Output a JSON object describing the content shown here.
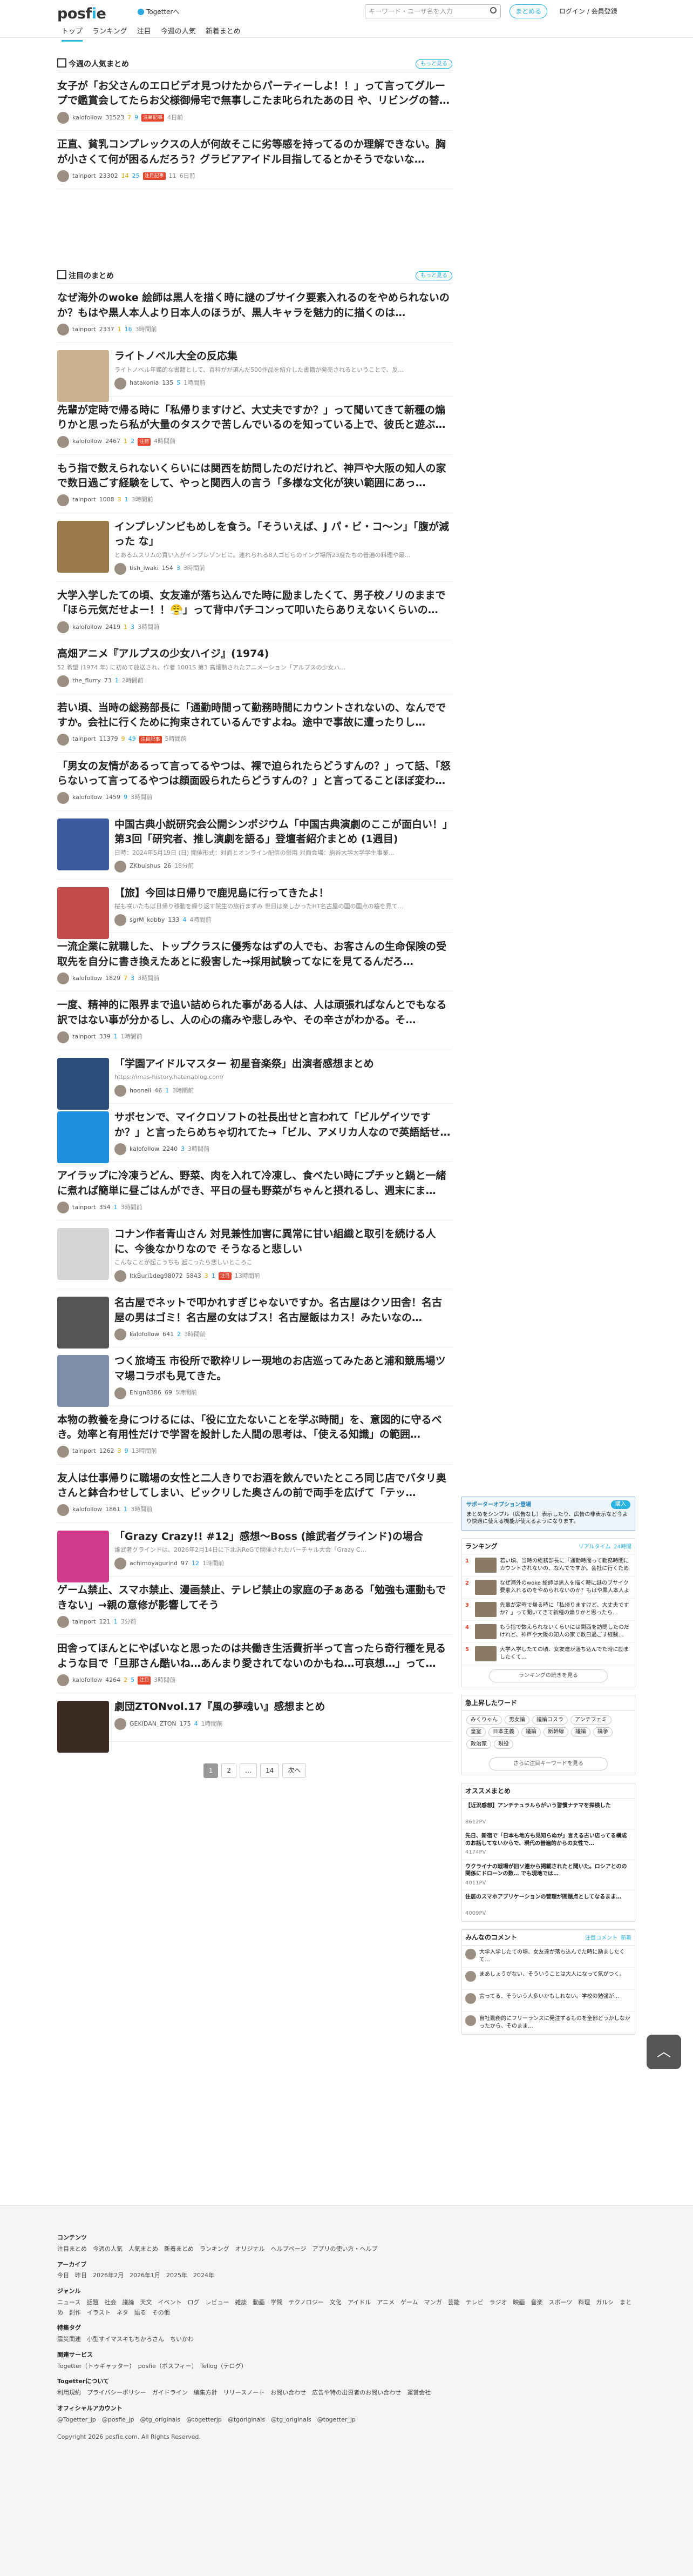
{
  "header": {
    "logo": "posfie",
    "togetter": "Togetterへ",
    "nav": [
      "トップ",
      "ランキング",
      "注目",
      "今週の人気",
      "新着まとめ"
    ],
    "search_placeholder": "キーワード・ユーザ名を入力",
    "create": "まとめる",
    "login": "ログイン / 会員登録"
  },
  "weekly": {
    "title": "今週の人気まとめ",
    "more": "もっと見る",
    "items": [
      {
        "title": "女子が「お父さんのエロビデオ見つけたからパーティーしよ！！」って言ってグループで鑑賞会してたらお父様御帰宅で無事しこたま叱られたあの日 や、リビングの替…",
        "user": "kalofollow",
        "views": "31523",
        "a": "7",
        "b": "9",
        "hot": "注目記事",
        "date": "4日前"
      },
      {
        "title": "正直、貧乳コンプレックスの人が何故そこに劣等感を持ってるのか理解できない。胸が小さくて何が困るんだろう？グラビアアイドル目指してるとかそうでないな…",
        "user": "tainport",
        "views": "23302",
        "a": "14",
        "b": "25",
        "hot": "注目記事",
        "c": "11",
        "date": "6日前"
      }
    ]
  },
  "feature": {
    "title": "注目のまとめ",
    "more": "もっと見る",
    "items": [
      {
        "title": "なぜ海外のwoke 絵師は黒人を描く時に謎のブサイク要素入れるのをやめられないのか？もはや黒人本人より日本人のほうが、黒人キャラを魅力的に描くのは…",
        "user": "tainport",
        "views": "2337",
        "a": "1",
        "b": "16",
        "date": "3時間前"
      },
      {
        "title": "ライトノベル大全の反応集",
        "sub": "ライトノベル年鑑的な書籍として、百科がが選んだ500作品を紹介した書籍が発売されるということで、反…",
        "user": "hatakonia",
        "views": "135",
        "a": "",
        "b": "5",
        "date": "1時間前",
        "thumb": "#c9b18f"
      },
      {
        "title": "先輩が定時で帰る時に「私帰りますけど、大丈夫ですか？」って聞いてきて新種の煽りかと思ったら私が大量のタスクで苦しんでいるのを知っている上で、彼氏と遊ぶ…",
        "user": "kalofollow",
        "views": "2467",
        "a": "1",
        "b": "2",
        "hot": "注目",
        "date": "4時間前"
      },
      {
        "title": "もう指で数えられないくらいには関西を訪問したのだけれど、神戸や大阪の知人の家で数日過ごす経験をして、やっと関西人の言う「多様な文化が狭い範囲にあっ…",
        "user": "tainport",
        "views": "1008",
        "a": "3",
        "b": "1",
        "date": "3時間前"
      },
      {
        "title": "インプレゾンビもめしを食う。「そういえば、J パ・ビ・コ〜ン」「腹が減った な」",
        "sub": "とあるムスリムの買い入がインプレゾンビに。連れられる8人ゴビらのイング場所23度たちの普遍の料理や最…",
        "user": "tish_iwaki",
        "views": "154",
        "a": "",
        "b": "3",
        "date": "3時間前",
        "thumb": "#9a7a4c"
      },
      {
        "title": "大学入学したての頃、女友達が落ち込んでた時に励ましたくて、男子校ノリのままで「ほら元気だせよー！！😤」って背中パチコンって叩いたらありえないくらいの…",
        "user": "kalofollow",
        "views": "2419",
        "a": "1",
        "b": "3",
        "date": "3時間前"
      },
      {
        "title": "高畑アニメ『アルプスの少女ハイジ』(1974)",
        "sub": "52 希望 (1974 年) に初めて放送され、作者 1001S 第3 高畑勲されたアニメーション「アルプスの少女ハ…",
        "user": "the_flurry",
        "views": "73",
        "a": "",
        "b": "1",
        "date": "2時間前"
      },
      {
        "title": "若い頃、当時の総務部長に「通勤時間って勤務時間にカウントされないの、なんでですか。会社に行くために拘束されているんですよね。途中で事故に遭ったりし…",
        "user": "tainport",
        "views": "11379",
        "a": "9",
        "b": "49",
        "hot": "注目記事",
        "date": "5時間前"
      },
      {
        "title": "「男女の友情があるって言ってるやつは、裸で迫られたらどうすんの？」って話、「怒らないって言ってるやつは顔面殴られたらどうすんの？」と言ってることほぼ変わ…",
        "user": "kalofollow",
        "views": "1459",
        "a": "",
        "b": "9",
        "date": "3時間前"
      },
      {
        "title": "中国古典小説研究会公開シンポジウム「中国古典演劇のここが面白い！」第3回「研究者、推し演劇を語る」登壇者紹介まとめ (1週目)",
        "sub": "日時：2024年5月19日 (日) 開催形式：対面とオンライン配信の併用 対面会場：駒谷大学大学学生事業…",
        "user": "ZKbuishus",
        "views": "26",
        "a": "",
        "b": "",
        "c": "",
        "date": "18分前",
        "thumb": "#3a5ba0"
      },
      {
        "title": "【旅】今回は日帰りで鹿児島に行ってきたよ！",
        "sub": "桜も咲いたもば日帰り移動を繰り返す院生の旅行まずみ 世日は楽しかったHT名古屋の国の国点の桜を見て…",
        "user": "sgrM_kobby",
        "views": "133",
        "a": "",
        "b": "4",
        "date": "4時間前",
        "thumb": "#c44b4b"
      },
      {
        "title": "一流企業に就職した、トップクラスに優秀なはずの人でも、お客さんの生命保険の受取先を自分に書き換えたあとに殺害した→採用試験ってなにを見てるんだろ…",
        "user": "kalofollow",
        "views": "1829",
        "a": "7",
        "b": "3",
        "date": "3時間前"
      },
      {
        "title": "一度、精神的に限界まで追い詰められた事がある人は、人は頑張ればなんとでもなる訳ではない事が分かるし、人の心の痛みや悲しみや、その辛さがわかる。そ…",
        "user": "tainport",
        "views": "339",
        "a": "",
        "b": "1",
        "date": "1時間前"
      },
      {
        "title": "「学園アイドルマスター 初星音楽祭」出演者感想まとめ",
        "sub": "https://imas-history.hatenablog.com/",
        "user": "hoonell",
        "views": "46",
        "a": "",
        "b": "1",
        "date": "3時間前",
        "thumb": "#2a4f7a"
      },
      {
        "title": "サボセンで、マイクロソフトの社長出せと言われて「ビルゲイツですか？」と言ったらめちゃ切れてた→「ビル、アメリカ人なので英語話せ…",
        "user": "kalofollow",
        "views": "2240",
        "a": "",
        "b": "3",
        "date": "3時間前",
        "thumb": "#1f8fe0"
      },
      {
        "title": "アイラップに冷凍うどん、野菜、肉を入れて冷凍し、食べたい時にプチッと鍋と一緒に煮れば簡単に昼ごはんができ、平日の昼も野菜がちゃんと摂れるし、週末にま…",
        "user": "tainport",
        "views": "354",
        "a": "",
        "b": "1",
        "date": "3時間前"
      },
      {
        "title": "コナン作者青山さん 対見兼性加害に異常に甘い組織と取引を続ける人に、今後なかりなので そうなると悲しい",
        "sub": "こんなことが起こうちも 起こったら悲しいところこ",
        "user": "ItkBuri1deg98072",
        "views": "5843",
        "a": "3",
        "b": "1",
        "hot": "注目",
        "date": "13時間前",
        "thumb": "#d5d5d5"
      },
      {
        "title": "名古屋でネットで叩かれすぎじゃないですか。名古屋はクソ田舎！名古屋の男はゴミ！名古屋の女はブス！名古屋飯はカス！みたいなの…",
        "user": "kalofollow",
        "views": "641",
        "a": "",
        "b": "2",
        "date": "3時間前",
        "thumb": "#555555"
      },
      {
        "title": "つく旅埼玉 市役所で歌枠リレー現地のお店巡ってみたあと浦和競馬場ツマ場コラボも見てきた。",
        "user": "Ehign8386",
        "views": "69",
        "a": "",
        "b": "",
        "c": "",
        "date": "5時間前",
        "thumb": "#7d8ea8"
      },
      {
        "title": "本物の教養を身につけるには、「役に立たないことを学ぶ時間」を、意図的に守るべき。効率と有用性だけで学習を設計した人間の思考は、「使える知識」の範囲…",
        "user": "tainport",
        "views": "1262",
        "a": "3",
        "b": "9",
        "date": "13時間前"
      },
      {
        "title": "友人は仕事帰りに職場の女性と二人きりでお酒を飲んでいたところ同じ店でバタリ奥さんと鉢合わせしてしまい、ビックリした奥さんの前で両手を広げて「テッ…",
        "user": "kalofollow",
        "views": "1861",
        "a": "",
        "b": "1",
        "date": "3時間前"
      },
      {
        "title": "「Grazy Crazy!! #12」感想〜Boss (誰武者グラインド)の場合",
        "sub": "誰武者グラインドは、2026年2月14日に下北沢ReGで開催されたバーチャル大会「Grazy C…",
        "user": "achimoyagurind",
        "views": "97",
        "a": "",
        "b": "12",
        "date": "1時間前",
        "thumb": "#d03a8a"
      },
      {
        "title": "ゲーム禁止、スマホ禁止、漫画禁止、テレビ禁止の家庭の子ぁある「勉強も運動もできない」→親の意修が影響してそう",
        "user": "tainport",
        "views": "121",
        "a": "",
        "b": "1",
        "date": "3分前"
      },
      {
        "title": "田舎ってほんとにやばいなと思ったのは共働き生活費折半って言ったら奇行種を見るような目で「旦那さん酷いね…あんまり愛されてないのかもね…可哀想…」って…",
        "user": "kalofollow",
        "views": "4264",
        "a": "2",
        "b": "5",
        "hot": "注目",
        "date": "3時間前"
      },
      {
        "title": "劇団ZTONvol.17『風の夢魂い』感想まとめ",
        "user": "GEKIDAN_ZTON",
        "views": "175",
        "a": "",
        "b": "4",
        "date": "1時間前",
        "thumb": "#3b2a22"
      }
    ]
  },
  "pager": [
    "1",
    "2",
    "…",
    "14",
    "次へ"
  ],
  "sidebar": {
    "support_title": "サポーターオプション登場",
    "support_text": "まとめをシンプル（広告なし）表示したり、広告の非表示など今より快適に使える機能が使えるようになります。",
    "support_btn": "購入",
    "ranking_title": "ランキング",
    "ranking_tabs": [
      "リアルタイム",
      "24時間"
    ],
    "ranking": [
      "若い頃、当時の総務部長に「通勤時間って勤務時間にカウントされないの、なんでですか。会社に行くために…",
      "なぜ海外のwoke 絵師は黒人を描く時に謎のブサイク要素入れるのをやめられないのか？もはや黒人本人より…",
      "先輩が定時で帰る時に「私帰りますけど、大丈夫ですか？」って聞いてきて新種の煽りかと思ったら…",
      "もう指で数えられないくらいには関西を訪問したのだけれど、神戸や大阪の知人の家で数日過ごす経験…",
      "大学入学したての頃、女友達が落ち込んでた時に励ましたくて…"
    ],
    "ranking_more": "ランキングの続きを見る",
    "words_title": "急上昇したワード",
    "words": [
      "みくりゃん",
      "男女論",
      "議論コスラ",
      "アンチフェミ",
      "皇室",
      "日本主義",
      "議論",
      "新幹線",
      "議論",
      "論争",
      "政治家",
      "現役"
    ],
    "words_more": "さらに注目キーワードを見る",
    "rec_title": "オススメまとめ",
    "rec": [
      {
        "t": "【近況感想】アンチテュラルらがいう習慣ナテマを探検した",
        "m": "8612PV"
      },
      {
        "t": "先日、新宿で「日本も地方も見知らぬが」言える古い店ってる構成のお話してないからで、現代の普遍的からの女性で…",
        "m": "4174PV"
      },
      {
        "t": "ウクライナの戦場が旧ソ連から掲載されたと聞いた。ロシアとのの関係にドローンの数… でも現地では…",
        "m": "4011PV"
      },
      {
        "t": "住居のスマホアプリケーションの管理が問題点としてなるまま…",
        "m": "4009PV"
      }
    ],
    "comments_title": "みんなのコメント",
    "comments_tabs": [
      "注目コメント",
      "新着"
    ],
    "comments": [
      "大学入学したての頃、女友達が落ち込んでた時に励ましたくて…",
      "まあしょうがない、そういうことは大人になって気がつく。",
      "言ってる、そういう人多いかもしれない。学校の勉強が…",
      "自社勤務的にフリーランスに発注するものを全部どうかしなかったから、そのまま…"
    ]
  },
  "gotop": "︿",
  "footer": {
    "contents_h": "コンテンツ",
    "contents": "注目まとめ　今週の人気　人気まとめ　新着まとめ　ランキング　オリジナル　ヘルプページ　アプリの使い方・ヘルプ",
    "archive_h": "アーカイブ",
    "archive": "今日　昨日　2026年2月　2026年1月　2025年　2024年",
    "genre_h": "ジャンル",
    "genre": "ニュース　話題　社会　議論　天文　イベント　ログ　レビュー　雑談　動画　学問　テクノロジー　文化　アイドル　アニメ　ゲーム　マンガ　芸能　テレビ　ラジオ　映画　音楽　スポーツ　料理　ガルシ　まとめ　創作　イラスト　ネタ　語る　その他",
    "special_h": "特集タグ",
    "special": "震災関連　小型すイマスキもちかろさん　ちいかわ",
    "service_h": "関連サービス",
    "service": "Togetter（トゥギャッター）　posfie（ポスフィー）　Tellog（テログ）",
    "about_h": "Togetterについて",
    "about": "利用規約　プライバシーポリシー　ガイドライン　編集方針　リリースノート　お問い合わせ　広告や特の出資者のお問い合わせ　運営会社",
    "official_h": "オフィシャルアカウント",
    "official": "@Togetter_jp　@posfie_jp　@tg_originals　@togetterjp　@tgoriginals　@tg_originals　@togetter_jp",
    "copyright": "Copyright 2026 posfie.com. All Rights Reserved."
  }
}
